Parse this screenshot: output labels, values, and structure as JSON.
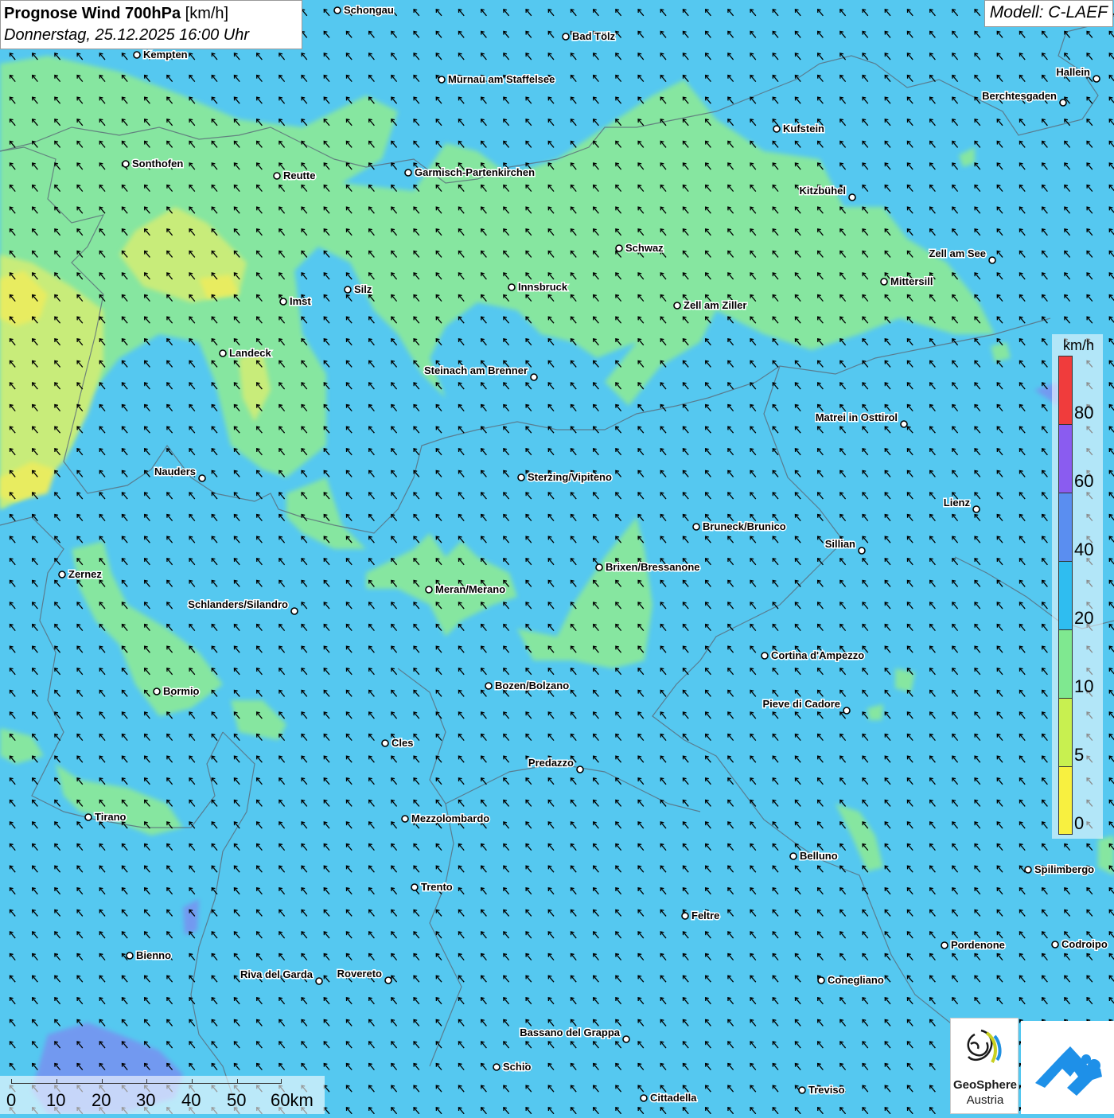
{
  "title": {
    "bold": "Prognose Wind 700hPa",
    "unit": " [km/h]",
    "date": "Donnerstag, 25.12.2025 16:00 Uhr"
  },
  "model": "Modell: C-LAEF",
  "legend": {
    "unit": "km/h",
    "labels": [
      "80",
      "60",
      "40",
      "20",
      "10",
      "5",
      "0"
    ],
    "colors": [
      "#f03c3c",
      "#8a5cf0",
      "#5a8ef0",
      "#2fbdf0",
      "#7fe890",
      "#c8f050",
      "#f8f040"
    ]
  },
  "scalebar": {
    "labels": [
      "0",
      "10",
      "20",
      "30",
      "40",
      "50",
      "60km"
    ]
  },
  "logos": {
    "geosphere_line1": "GeoSphere",
    "geosphere_line2": "Austria"
  },
  "wind_direction": "north-west",
  "cities": [
    {
      "name": "Schongau",
      "label_side": "right"
    },
    {
      "name": "Bad Tölz",
      "label_side": "right"
    },
    {
      "name": "Kempten",
      "label_side": "right"
    },
    {
      "name": "Murnau am Staffelsee",
      "label_side": "right"
    },
    {
      "name": "Hallein",
      "label_side": "left"
    },
    {
      "name": "Berchtesgaden",
      "label_side": "left"
    },
    {
      "name": "Kufstein",
      "label_side": "right"
    },
    {
      "name": "Sonthofen",
      "label_side": "right"
    },
    {
      "name": "Reutte",
      "label_side": "right"
    },
    {
      "name": "Garmisch-Partenkirchen",
      "label_side": "right"
    },
    {
      "name": "Kitzbühel",
      "label_side": "left"
    },
    {
      "name": "Schwaz",
      "label_side": "right"
    },
    {
      "name": "Zell am See",
      "label_side": "left"
    },
    {
      "name": "Mittersill",
      "label_side": "right"
    },
    {
      "name": "Silz",
      "label_side": "right"
    },
    {
      "name": "Innsbruck",
      "label_side": "right"
    },
    {
      "name": "Imst",
      "label_side": "right"
    },
    {
      "name": "Zell am Ziller",
      "label_side": "right"
    },
    {
      "name": "Landeck",
      "label_side": "right"
    },
    {
      "name": "Steinach am Brenner",
      "label_side": "left"
    },
    {
      "name": "Matrei in Osttirol",
      "label_side": "left"
    },
    {
      "name": "Nauders",
      "label_side": "left"
    },
    {
      "name": "Sterzing/Vipiteno",
      "label_side": "right"
    },
    {
      "name": "Lienz",
      "label_side": "left"
    },
    {
      "name": "Bruneck/Brunico",
      "label_side": "right"
    },
    {
      "name": "Sillian",
      "label_side": "left"
    },
    {
      "name": "Brixen/Bressanone",
      "label_side": "right"
    },
    {
      "name": "Zernez",
      "label_side": "right"
    },
    {
      "name": "Meran/Merano",
      "label_side": "right"
    },
    {
      "name": "Schlanders/Silandro",
      "label_side": "left"
    },
    {
      "name": "Cortina d'Ampezzo",
      "label_side": "right"
    },
    {
      "name": "Bozen/Bolzano",
      "label_side": "right"
    },
    {
      "name": "Bormio",
      "label_side": "right"
    },
    {
      "name": "Pieve di Cadore",
      "label_side": "left"
    },
    {
      "name": "Cles",
      "label_side": "right"
    },
    {
      "name": "Predazzo",
      "label_side": "left"
    },
    {
      "name": "Tirano",
      "label_side": "right"
    },
    {
      "name": "Mezzolombardo",
      "label_side": "right"
    },
    {
      "name": "Belluno",
      "label_side": "right"
    },
    {
      "name": "Spilimbergo",
      "label_side": "right"
    },
    {
      "name": "Trento",
      "label_side": "right"
    },
    {
      "name": "Feltre",
      "label_side": "right"
    },
    {
      "name": "Pordenone",
      "label_side": "right"
    },
    {
      "name": "Codroipo",
      "label_side": "right"
    },
    {
      "name": "Bienno",
      "label_side": "right"
    },
    {
      "name": "Riva del Garda",
      "label_side": "left"
    },
    {
      "name": "Rovereto",
      "label_side": "left"
    },
    {
      "name": "Conegliano",
      "label_side": "right"
    },
    {
      "name": "Bassano del Grappa",
      "label_side": "left"
    },
    {
      "name": "Schio",
      "label_side": "right"
    },
    {
      "name": "Treviso",
      "label_side": "right"
    },
    {
      "name": "Cittadella",
      "label_side": "right"
    }
  ]
}
